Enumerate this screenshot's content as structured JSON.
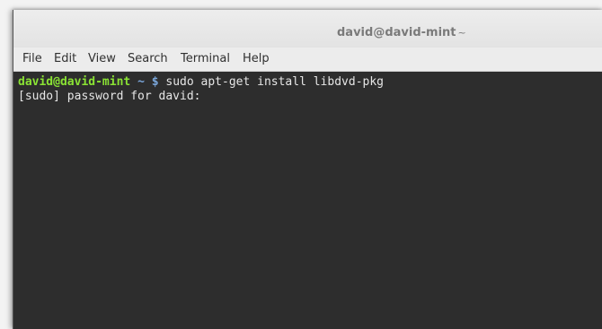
{
  "window": {
    "title": "david@david-mint",
    "title_suffix": "~"
  },
  "menubar": {
    "items": [
      "File",
      "Edit",
      "View",
      "Search",
      "Terminal",
      "Help"
    ]
  },
  "terminal": {
    "prompt_user_host": "david@david-mint",
    "prompt_path": "~ $",
    "command": "sudo apt-get install libdvd-pkg",
    "output_line": "[sudo] password for david:"
  },
  "colors": {
    "prompt_green": "#8ae234",
    "prompt_blue": "#7aa6da",
    "terminal_bg": "#2d2d2d",
    "text": "#e6e6e6"
  }
}
